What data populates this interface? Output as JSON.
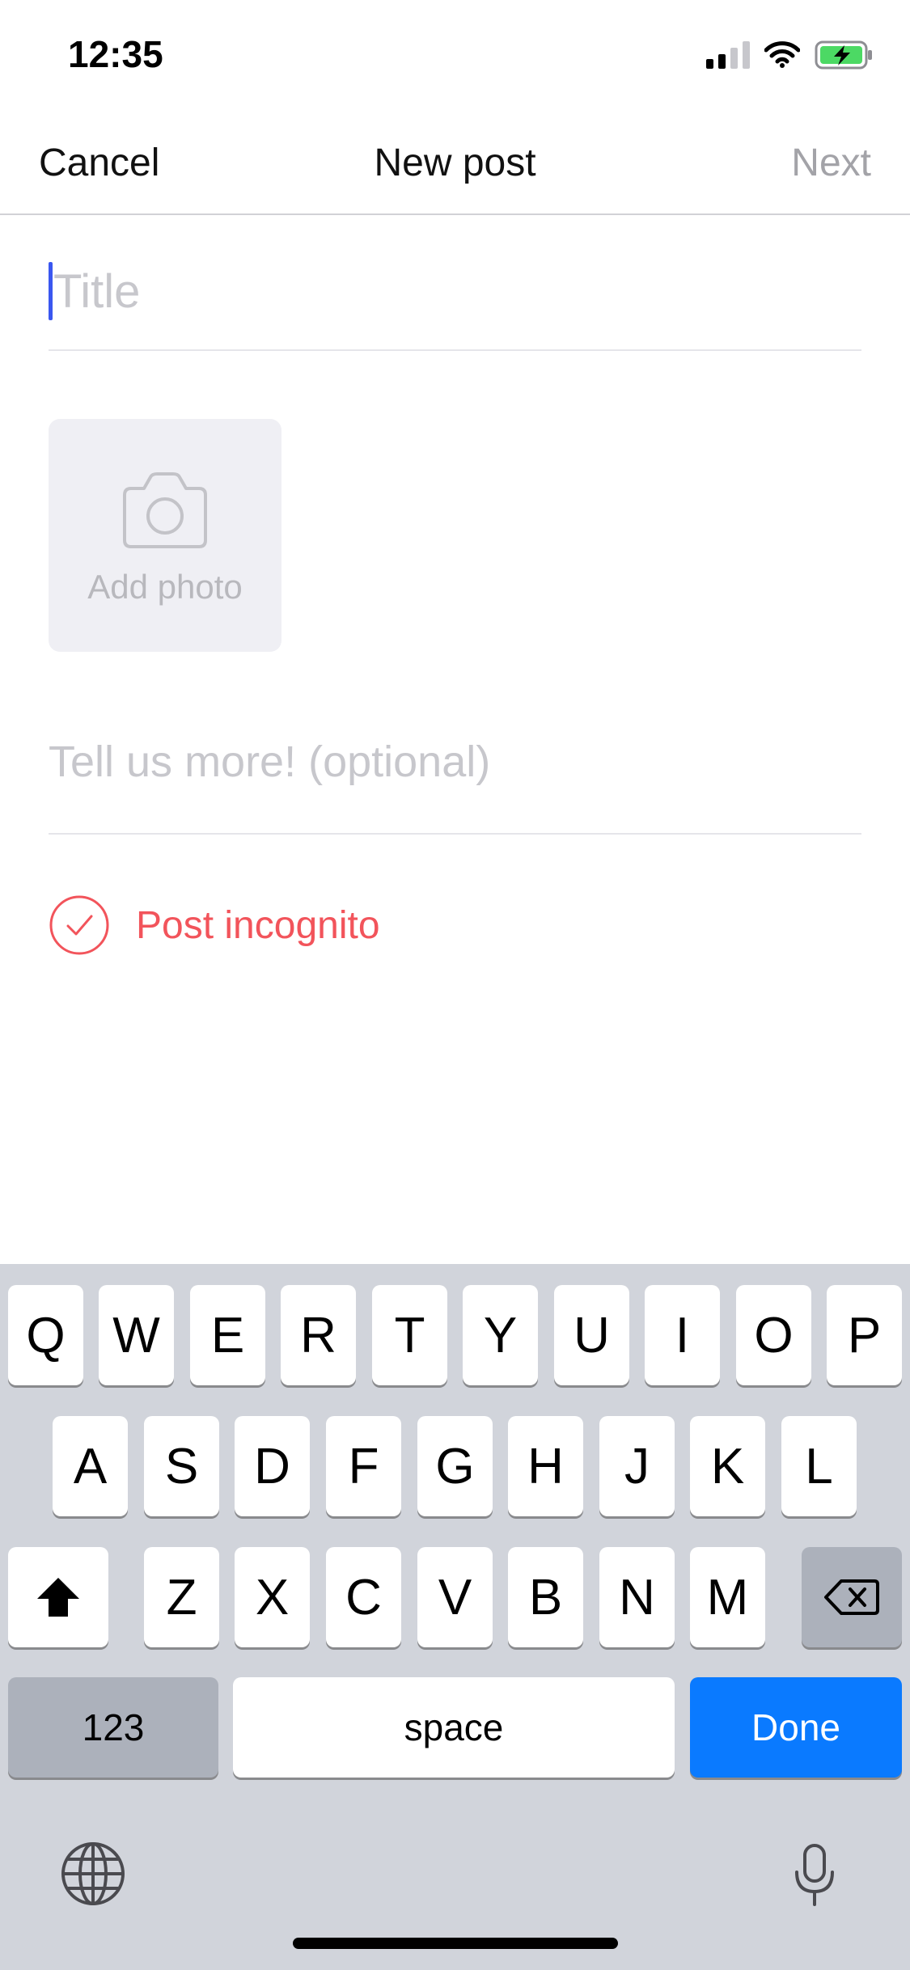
{
  "status_bar": {
    "time": "12:35",
    "icons": [
      "signal-icon",
      "wifi-icon",
      "battery-charging-icon"
    ],
    "battery_color": "#4cd964"
  },
  "nav": {
    "cancel": "Cancel",
    "title": "New post",
    "next": "Next"
  },
  "form": {
    "title_placeholder": "Title",
    "title_value": "",
    "add_photo": "Add photo",
    "description_placeholder": "Tell us more! (optional)",
    "description_value": "",
    "incognito_label": "Post incognito",
    "incognito_checked": true,
    "incognito_color": "#f2545b",
    "caret_color": "#3a57f0"
  },
  "keyboard": {
    "row1": [
      "Q",
      "W",
      "E",
      "R",
      "T",
      "Y",
      "U",
      "I",
      "O",
      "P"
    ],
    "row2": [
      "A",
      "S",
      "D",
      "F",
      "G",
      "H",
      "J",
      "K",
      "L"
    ],
    "row3": [
      "Z",
      "X",
      "C",
      "V",
      "B",
      "N",
      "M"
    ],
    "numbers": "123",
    "space": "space",
    "done": "Done",
    "done_color": "#0a7aff",
    "icons": [
      "shift-icon",
      "backspace-icon",
      "globe-icon",
      "microphone-icon"
    ]
  }
}
